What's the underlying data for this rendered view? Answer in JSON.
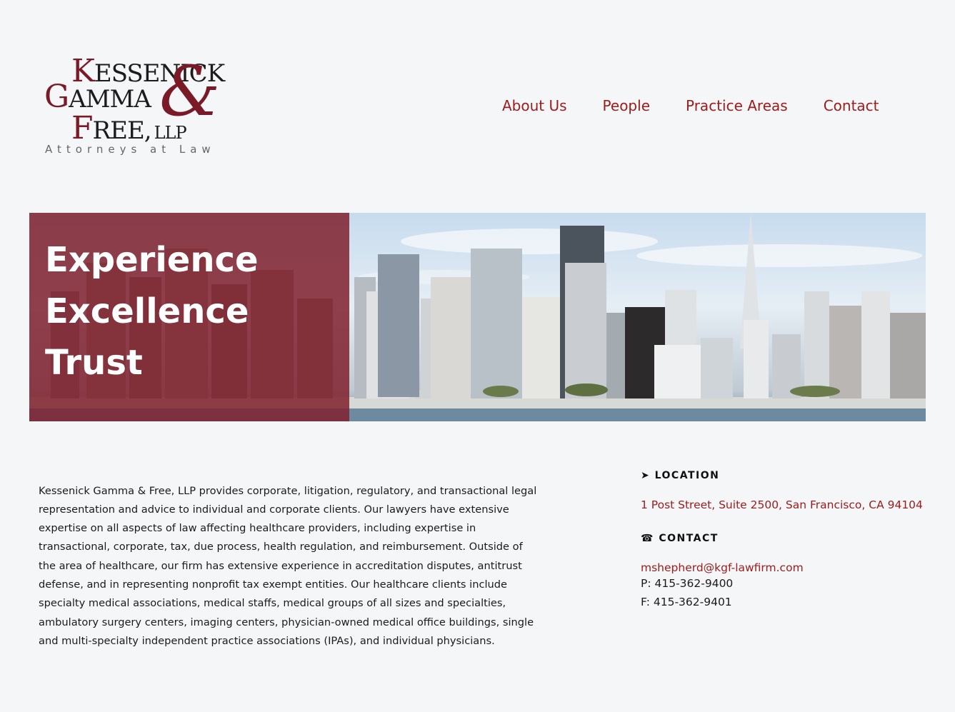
{
  "logo": {
    "line1": "KESSENICK",
    "line2": "GAMMA",
    "line3": "FREE,",
    "llp": "LLP",
    "amp": "&",
    "tagline": "Attorneys at Law"
  },
  "nav": {
    "items": [
      {
        "label": "About Us"
      },
      {
        "label": "People"
      },
      {
        "label": "Practice Areas"
      },
      {
        "label": "Contact"
      }
    ]
  },
  "hero": {
    "words": [
      "Experience",
      "Excellence",
      "Trust"
    ]
  },
  "about": {
    "text": "Kessenick Gamma & Free, LLP provides corporate, litigation, regulatory, and transactional legal representation and advice to individual and corporate clients.  Our lawyers have extensive expertise on all aspects of law affecting healthcare providers, including expertise in transactional, corporate, tax, due process, health regulation, and reimbursement.  Outside of the area of healthcare, our firm has extensive experience in accreditation disputes, antitrust defense, and in representing nonprofit tax exempt entities.  Our healthcare clients include specialty medical associations, medical staffs, medical groups of all sizes and specialties, ambulatory surgery centers, imaging centers, physician-owned medical office buildings, single and multi-specialty independent practice associations (IPAs), and individual physicians."
  },
  "location": {
    "heading": "➤ LOCATION",
    "address": "1 Post Street, Suite 2500, San Francisco, CA 94104"
  },
  "contact": {
    "heading": "☎ CONTACT",
    "email": "mshepherd@kgf-lawfirm.com",
    "phone": "P: 415-362-9400",
    "fax": "F: 415-362-9401"
  },
  "colors": {
    "accent": "#9e1b1b",
    "overlay": "#80222f",
    "background": "#f5f6f8"
  }
}
